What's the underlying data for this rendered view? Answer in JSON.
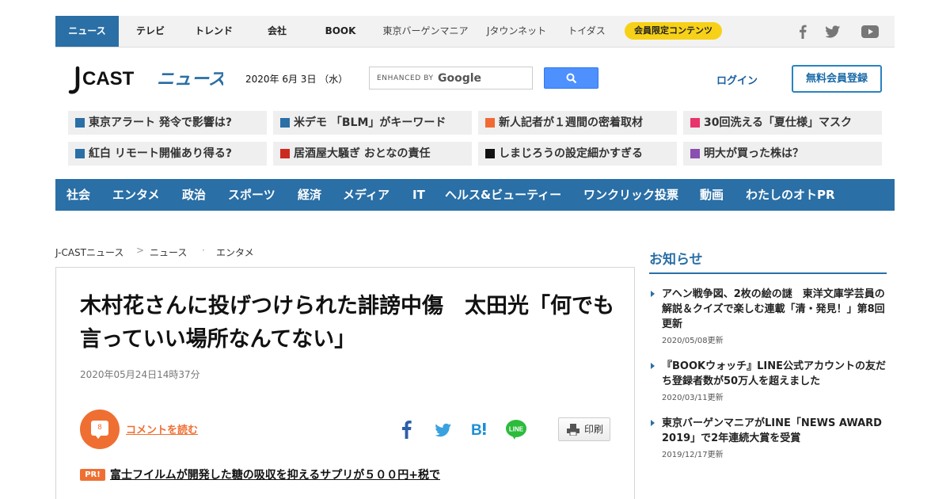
{
  "top_nav": {
    "items": [
      "ニュース",
      "テレビ",
      "トレンド",
      "会社",
      "BOOK",
      "東京バーゲンマニア",
      "Jタウンネット",
      "トイダス"
    ],
    "member_label": "会員限定コンテンツ",
    "social": [
      "facebook-icon",
      "twitter-icon",
      "youtube-icon"
    ]
  },
  "header": {
    "logo_main": "J CAST",
    "logo_sub": "ニュース",
    "date": "2020年 6月 3日 （水）",
    "search_enhanced": "ENHANCED BY",
    "search_brand": "Google",
    "login": "ログイン",
    "register": "無料会員登録"
  },
  "topics": [
    {
      "label": "東京アラート 発令で影響は?",
      "color": "#2a6fa6"
    },
    {
      "label": "米デモ 「BLM」がキーワード",
      "color": "#2a6fa6"
    },
    {
      "label": "新人記者が１週間の密着取材",
      "color": "#f06a35"
    },
    {
      "label": "30回洗える「夏仕様」マスク",
      "color": "#e8336d"
    },
    {
      "label": "紅白 リモート開催あり得る?",
      "color": "#2a6fa6"
    },
    {
      "label": "居酒屋大騒ぎ おとなの責任",
      "color": "#cc2a1f"
    },
    {
      "label": "しまじろうの設定細かすぎる",
      "color": "#111111"
    },
    {
      "label": "明大が買った株は？",
      "color": "#8a4fb0"
    }
  ],
  "categories": [
    "社会",
    "エンタメ",
    "政治",
    "スポーツ",
    "経済",
    "メディア",
    "IT",
    "ヘルス&ビューティー",
    "ワンクリック投票",
    "動画",
    "わたしのオトPR"
  ],
  "breadcrumb": [
    "J-CASTニュース",
    "ニュース",
    "エンタメ"
  ],
  "article": {
    "title": "木村花さんに投げつけられた誹謗中傷　太田光「何でも言っていい場所なんてない」",
    "date": "2020年05月24日14時37分",
    "comment_count": "8",
    "comment_link": "コメントを読む",
    "print_label": "印刷",
    "pr_badge": "PR!",
    "pr_text": "富士フイルムが開発した糖の吸収を抑えるサプリが５００円+税で"
  },
  "sidebar": {
    "heading": "お知らせ",
    "news": [
      {
        "title": "アヘン戦争図、2枚の絵の謎　東洋文庫学芸員の解説＆クイズで楽しむ連載「清・発見！」第8回更新",
        "date": "2020/05/08更新"
      },
      {
        "title": "『BOOKウォッチ』LINE公式アカウントの友だち登録者数が50万人を超えました",
        "date": "2020/03/11更新"
      },
      {
        "title": "東京バーゲンマニアがLINE「NEWS AWARD 2019」で2年連続大賞を受賞",
        "date": "2019/12/17更新"
      }
    ]
  },
  "colors": {
    "brand_blue": "#2a6fa6",
    "accent_orange": "#ef6f32",
    "member_yellow": "#f7d117"
  }
}
